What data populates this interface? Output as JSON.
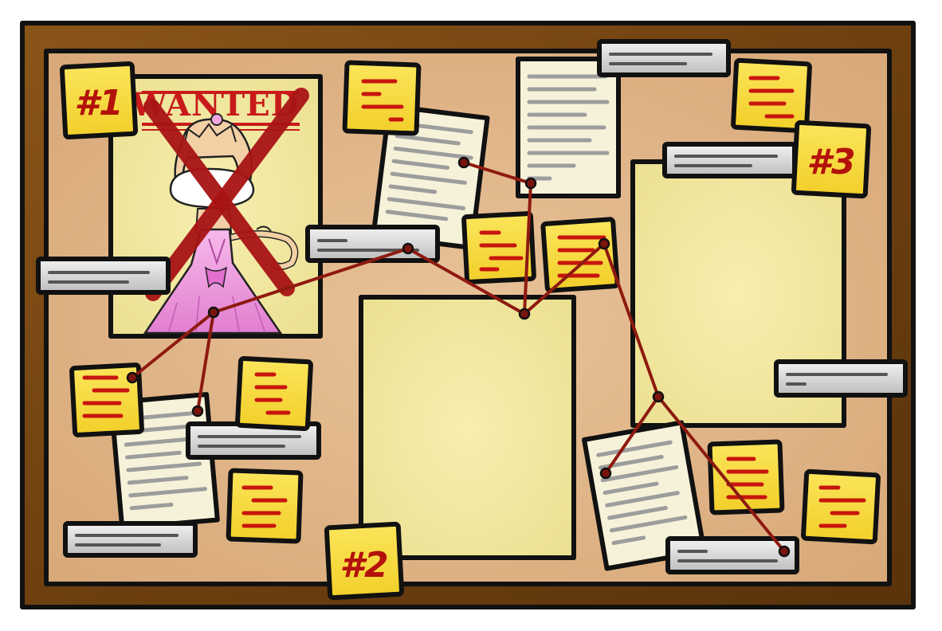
{
  "board": {
    "frame_color": "#7a4a12",
    "cork_color": "#e0b489",
    "paper_color": "#f5f0d0",
    "poster_color": "#f3e9a2",
    "note_color": "#f7dc3c",
    "string_color": "#9b1c10",
    "label_color": "#dcdcdc"
  },
  "poster": {
    "title": "WANTED",
    "crossed_out": true
  },
  "markers": [
    {
      "id": "1",
      "text": "#1"
    },
    {
      "id": "2",
      "text": "#2"
    },
    {
      "id": "3",
      "text": "#3"
    }
  ]
}
